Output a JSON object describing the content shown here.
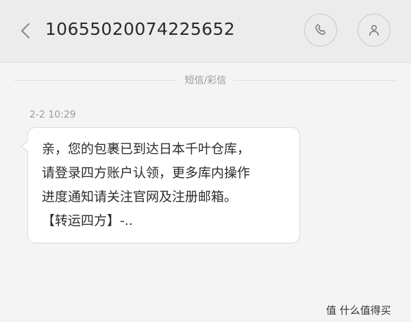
{
  "header": {
    "title": "10655020074225652",
    "back_icon": "chevron-left-icon",
    "call_icon": "phone-icon",
    "contact_icon": "person-icon"
  },
  "thread": {
    "divider_label": "短信/彩信",
    "messages": [
      {
        "timestamp": "2-2 10:29",
        "lines": [
          "亲，您的包裹已到达日本千叶仓库，",
          "请登录四方账户认领，更多库内操作",
          "进度通知请关注官网及注册邮箱。",
          "【转运四方】-.."
        ]
      }
    ]
  },
  "watermark": {
    "text": "值 什么值得买"
  },
  "colors": {
    "header_bg": "#ececec",
    "page_bg": "#f4f4f4",
    "bubble_bg": "#ffffff",
    "muted_text": "#9a9a9a"
  }
}
